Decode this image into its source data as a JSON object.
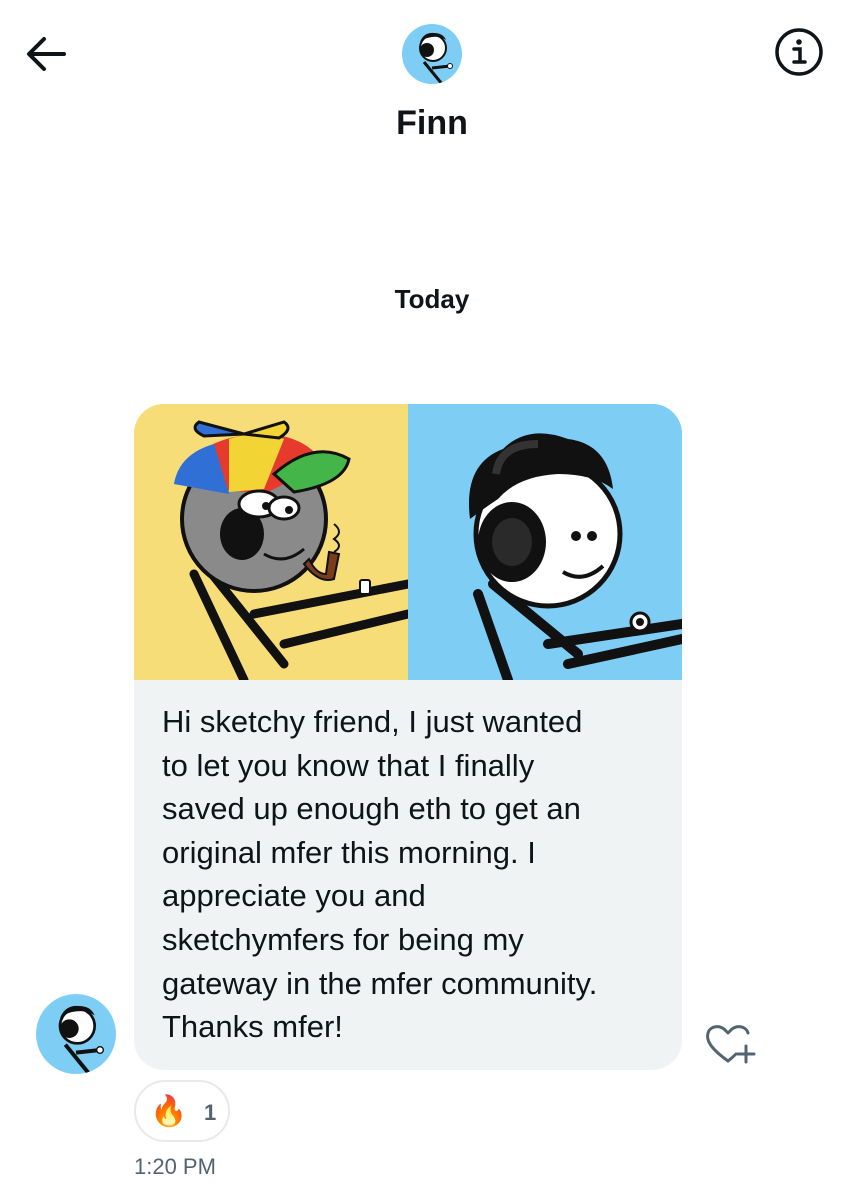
{
  "header": {
    "contact_name": "Finn",
    "back_icon": "arrow-left-icon",
    "info_icon": "info-icon"
  },
  "conversation": {
    "date_label": "Today",
    "message": {
      "text": "Hi sketchy friend, I just wanted\nto let you know that I finally\nsaved up enough eth to  get an\noriginal mfer this morning. I\nappreciate you and\nsketchymfers for being my\ngateway in the mfer community.\nThanks mfer!",
      "reaction_emoji": "🔥",
      "reaction_count": "1",
      "time": "1:20 PM",
      "react_icon": "heart-plus-icon"
    }
  },
  "colors": {
    "panel_left_bg": "#f7dd78",
    "panel_right_bg": "#7ecdf5",
    "avatar_bg": "#7ecdf5",
    "bubble_bg": "#eff3f4"
  }
}
